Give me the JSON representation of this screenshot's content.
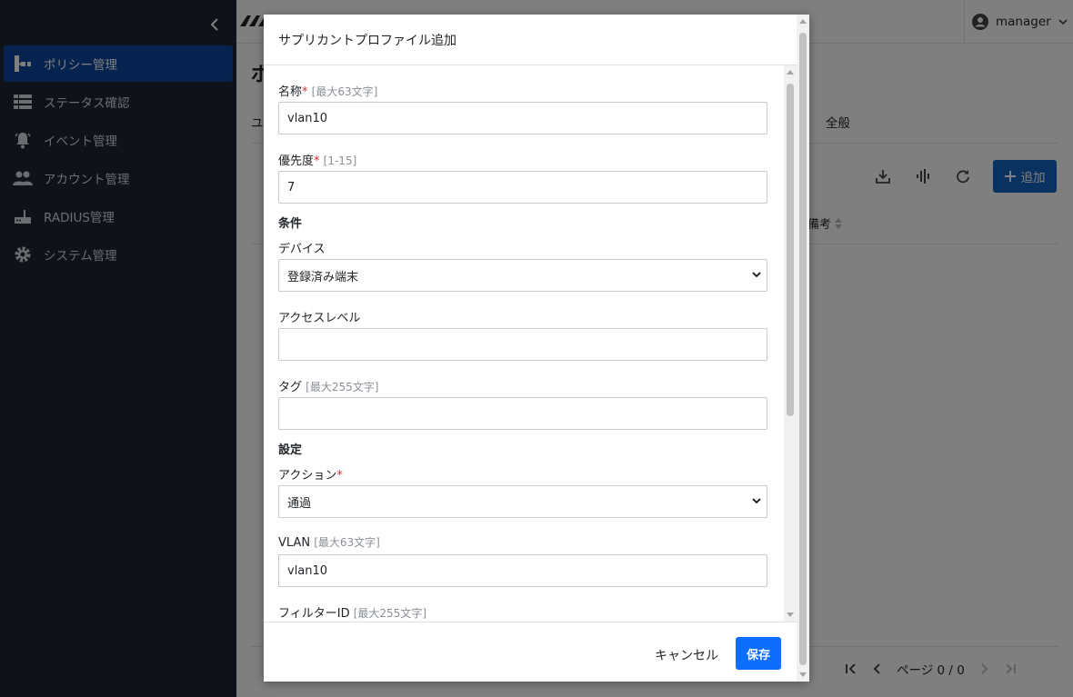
{
  "sidebar": {
    "items": [
      {
        "label": "ポリシー管理",
        "icon": "policy-icon",
        "active": true
      },
      {
        "label": "ステータス確認",
        "icon": "list-icon",
        "active": false
      },
      {
        "label": "イベント管理",
        "icon": "bell-icon",
        "active": false
      },
      {
        "label": "アカウント管理",
        "icon": "users-icon",
        "active": false
      },
      {
        "label": "RADIUS管理",
        "icon": "router-icon",
        "active": false
      },
      {
        "label": "システム管理",
        "icon": "gear-icon",
        "active": false
      }
    ]
  },
  "header": {
    "user_name": "manager"
  },
  "background": {
    "page_title": "ポ",
    "tab_first": "ユ",
    "tab_general": "全般",
    "add_label": "追加",
    "column_remarks": "備考",
    "pager_text": "ページ 0 / 0"
  },
  "modal": {
    "title": "サプリカントプロファイル追加",
    "fields": {
      "name": {
        "label": "名称",
        "hint": "[最大63文字]",
        "value": "vlan10"
      },
      "priority": {
        "label": "優先度",
        "hint": "[1-15]",
        "value": "7"
      },
      "device": {
        "label": "デバイス",
        "value": "登録済み端末"
      },
      "access_level": {
        "label": "アクセスレベル",
        "value": ""
      },
      "tag": {
        "label": "タグ",
        "hint": "[最大255文字]",
        "value": ""
      },
      "action": {
        "label": "アクション",
        "value": "通過"
      },
      "vlan": {
        "label": "VLAN",
        "hint": "[最大63文字]",
        "value": "vlan10"
      },
      "filter_id": {
        "label": "フィルターID",
        "hint": "[最大255文字]"
      }
    },
    "sections": {
      "conditions": "条件",
      "settings": "設定"
    },
    "required_mark": "*",
    "cancel_label": "キャンセル",
    "save_label": "保存"
  },
  "colors": {
    "sidebar_bg": "#1f2432",
    "active_item": "#0d47a1",
    "primary": "#0d6efd",
    "required": "#d32f2f"
  }
}
